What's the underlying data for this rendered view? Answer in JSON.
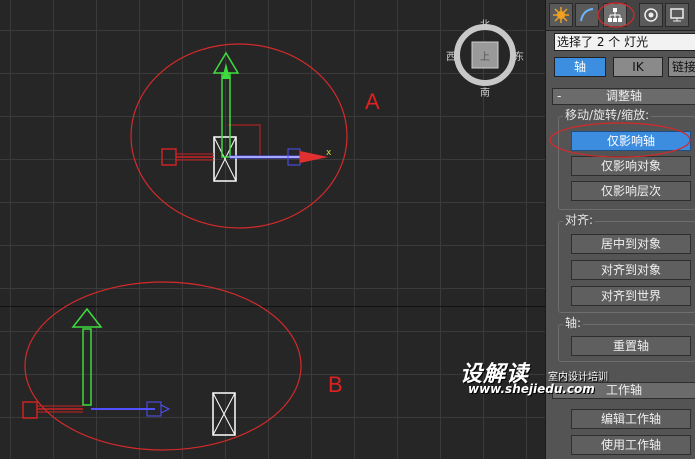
{
  "viewport": {
    "viewcube": {
      "north": "北",
      "south": "南",
      "east": "东",
      "west": "西",
      "face": "上"
    },
    "annotations": {
      "a": "A",
      "b": "B"
    },
    "gizmo_axis_x": "x"
  },
  "panel": {
    "tabs": [
      "create-icon",
      "modify-icon",
      "hierarchy-icon",
      "motion-icon",
      "display-icon"
    ],
    "selection_field": "选择了 2 个 灯光",
    "mode_buttons": {
      "pivot": "轴",
      "ik": "IK",
      "link": "链接信息"
    },
    "rollout": {
      "collapse": "-",
      "title": "调整轴"
    },
    "move_group": {
      "label": "移动/旋转/缩放:",
      "affect_pivot_only": "仅影响轴",
      "affect_object_only": "仅影响对象",
      "affect_hierarchy_only": "仅影响层次"
    },
    "align_group": {
      "label": "对齐:",
      "center_to_object": "居中到对象",
      "align_to_object": "对齐到对象",
      "align_to_world": "对齐到世界"
    },
    "pivot_group": {
      "label": "轴:",
      "reset_pivot": "重置轴"
    },
    "working_pivot": {
      "title": "工作轴",
      "edit_working_pivot": "编辑工作轴",
      "use_working_pivot": "使用工作轴"
    }
  },
  "watermark": {
    "brand": "设解读",
    "sub": "室内设计培训",
    "url": "www.shejiedu.com"
  },
  "colors": {
    "highlight": "#e02020",
    "active_blue": "#3c8de0",
    "y_axis": "#3fdc3f",
    "x_axis": "#5050ff"
  }
}
